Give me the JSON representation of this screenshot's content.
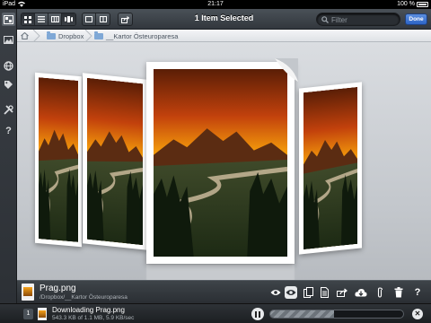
{
  "status_bar": {
    "carrier": "iPad",
    "time": "21:17",
    "battery": "100 %"
  },
  "toolbar": {
    "title": "1 Item Selected",
    "search_placeholder": "Filter",
    "done_label": "Done",
    "view_modes": [
      "grid-view-icon",
      "list-view-icon",
      "column-view-icon",
      "coverflow-view-icon"
    ],
    "pane_modes": [
      "single-pane-icon",
      "split-pane-icon"
    ],
    "share_icon": "share-icon"
  },
  "sidebar": {
    "items": [
      "files-icon",
      "photos-icon",
      "globe-icon",
      "tags-icon",
      "tools-icon",
      "help-icon"
    ]
  },
  "breadcrumb": {
    "home_icon": "home-icon",
    "items": [
      "Dropbox",
      "__Kartor Östeuroparesa"
    ]
  },
  "file_info": {
    "name": "Prag.png",
    "path": "/Dropbox/__Kartor Östeuroparesa",
    "actions": [
      "eye-icon",
      "preview-icon",
      "copy-icon",
      "document-icon",
      "share-icon",
      "download-cloud-icon",
      "paperclip-icon",
      "trash-icon",
      "help-icon"
    ]
  },
  "download": {
    "count": "1",
    "title": "Downloading Prag.png",
    "status": "543.3 KB of 1.1 MB, 5.9 KB/sec",
    "progress": 0.48
  },
  "colors": {
    "accent": "#2c63c4",
    "toolbar": "#3a3f45",
    "stage": "#c8ccd1"
  }
}
